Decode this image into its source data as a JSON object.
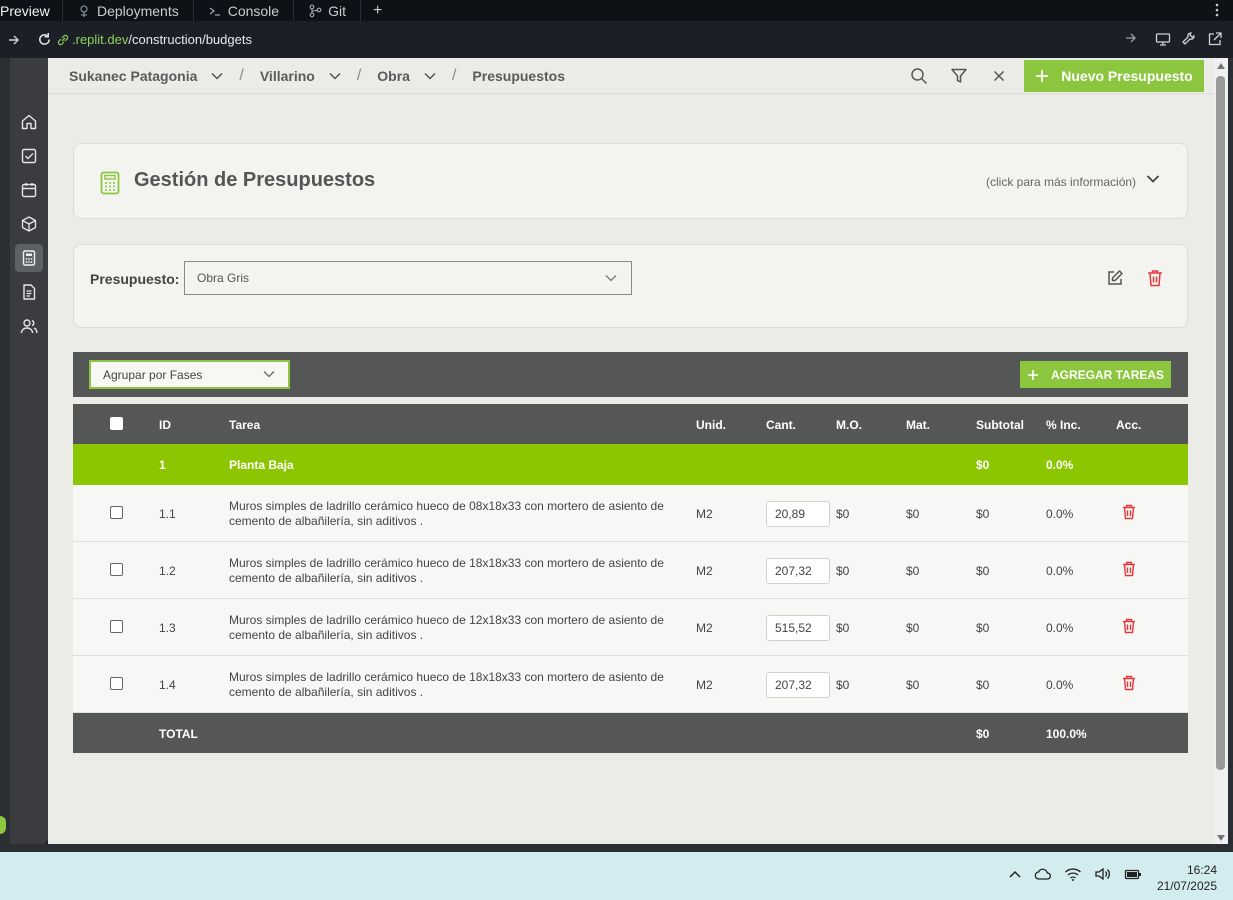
{
  "browser": {
    "first_tab": "Preview",
    "tabs": [
      {
        "label": "Deployments",
        "icon": "deploy-icon"
      },
      {
        "label": "Console",
        "icon": "terminal-icon"
      },
      {
        "label": "Git",
        "icon": "git-icon"
      }
    ],
    "add_tab": "+",
    "url_domain": ".replit.dev",
    "url_path": "/construction/budgets"
  },
  "sidebar": {
    "items": [
      {
        "icon": "home-icon",
        "active": false
      },
      {
        "icon": "tasks-icon",
        "active": false
      },
      {
        "icon": "calendar-icon",
        "active": false
      },
      {
        "icon": "package-icon",
        "active": false
      },
      {
        "icon": "calculator-icon",
        "active": true
      },
      {
        "icon": "document-icon",
        "active": false
      },
      {
        "icon": "users-icon",
        "active": false
      }
    ]
  },
  "header": {
    "breadcrumbs": [
      "Sukanec Patagonia",
      "Villarino",
      "Obra",
      "Presupuestos"
    ],
    "separator": "/",
    "new_button": "Nuevo Presupuesto"
  },
  "info_card": {
    "title": "Gestión de Presupuestos",
    "hint": "(click para más información)"
  },
  "budget_card": {
    "label": "Presupuesto:",
    "selected": "Obra Gris"
  },
  "toolbar": {
    "group_by": "Agrupar por Fases",
    "add_tasks": "AGREGAR TAREAS"
  },
  "table": {
    "headers": {
      "id": "ID",
      "task": "Tarea",
      "unit": "Unid.",
      "qty": "Cant.",
      "labor": "M.O.",
      "material": "Mat.",
      "subtotal": "Subtotal",
      "pct": "% Inc.",
      "actions": "Acc."
    },
    "phase": {
      "id": "1",
      "name": "Planta Baja",
      "subtotal": "$0",
      "pct": "0.0%"
    },
    "rows": [
      {
        "id": "1.1",
        "task": "Muros simples de ladrillo cerámico hueco de 08x18x33 con mortero de asiento de cemento de albañilería, sin aditivos .",
        "unit": "M2",
        "qty": "20,89",
        "labor": "$0",
        "material": "$0",
        "subtotal": "$0",
        "pct": "0.0%"
      },
      {
        "id": "1.2",
        "task": "Muros simples de ladrillo cerámico hueco de 18x18x33 con mortero de asiento de cemento de albañilería, sin aditivos .",
        "unit": "M2",
        "qty": "207,32",
        "labor": "$0",
        "material": "$0",
        "subtotal": "$0",
        "pct": "0.0%"
      },
      {
        "id": "1.3",
        "task": "Muros simples de ladrillo cerámico hueco de 12x18x33 con mortero de asiento de cemento de albañilería, sin aditivos .",
        "unit": "M2",
        "qty": "515,52",
        "labor": "$0",
        "material": "$0",
        "subtotal": "$0",
        "pct": "0.0%"
      },
      {
        "id": "1.4",
        "task": "Muros simples de ladrillo cerámico hueco de 18x18x33 con mortero de asiento de cemento de albañilería, sin aditivos .",
        "unit": "M2",
        "qty": "207,32",
        "labor": "$0",
        "material": "$0",
        "subtotal": "$0",
        "pct": "0.0%"
      }
    ],
    "total": {
      "label": "TOTAL",
      "subtotal": "$0",
      "pct": "100.0%"
    }
  },
  "taskbar": {
    "time": "16:24",
    "date": "21/07/2025"
  },
  "colors": {
    "accent_green": "#8cc63f",
    "phase_green": "#8cc600",
    "dark_header": "#555656",
    "danger_red": "#e03a3a",
    "url_domain": "#8fd45b"
  }
}
